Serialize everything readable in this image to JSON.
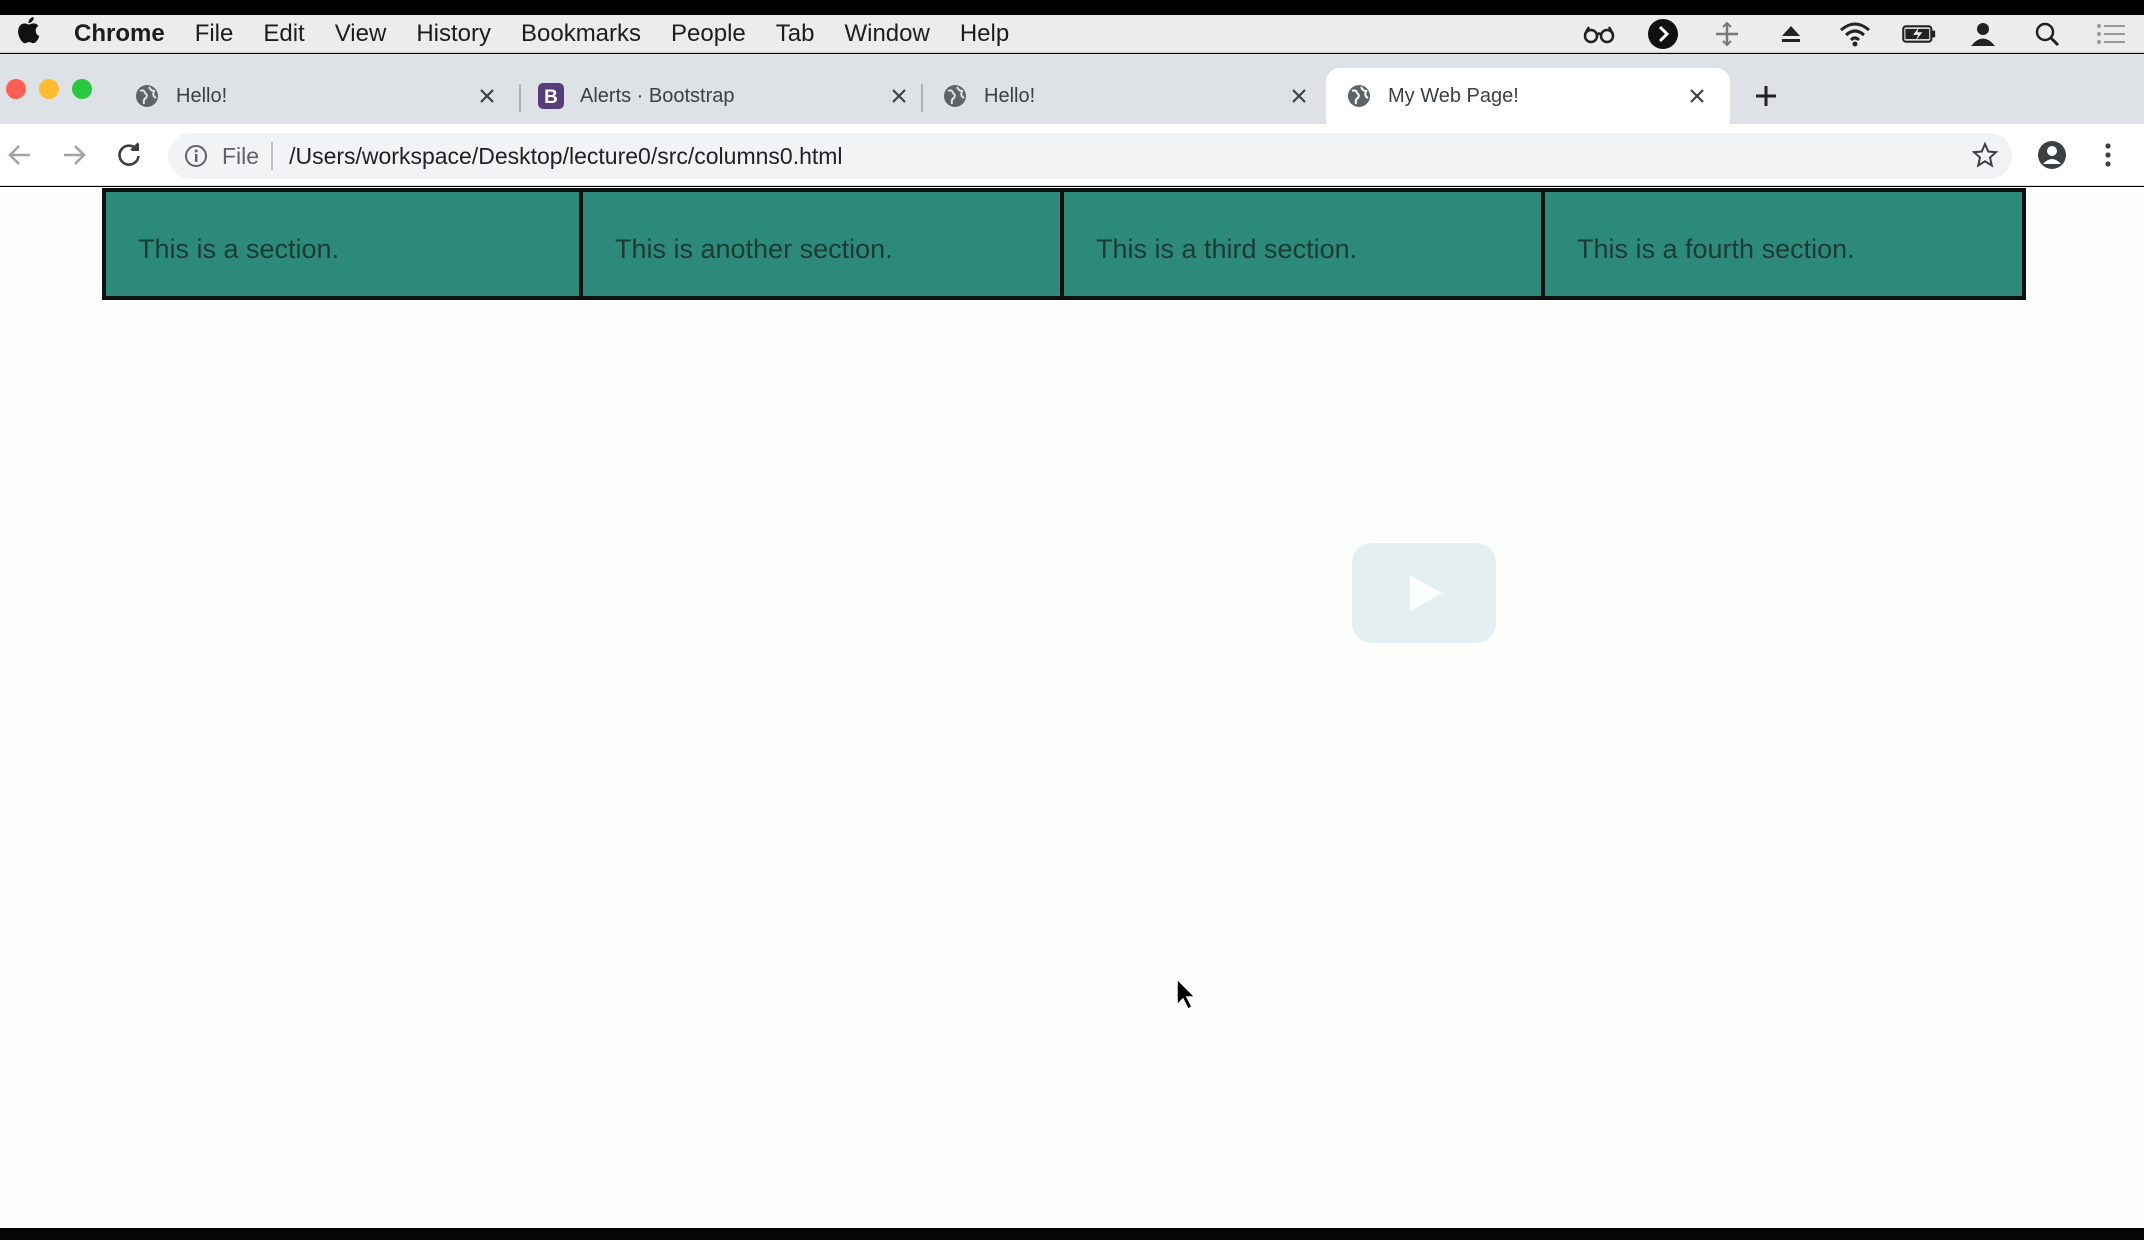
{
  "menubar": {
    "app_name": "Chrome",
    "items": [
      "File",
      "Edit",
      "View",
      "History",
      "Bookmarks",
      "People",
      "Tab",
      "Window",
      "Help"
    ]
  },
  "tabs": [
    {
      "title": "Hello!",
      "favicon": "globe-icon",
      "active": false
    },
    {
      "title": "Alerts · Bootstrap",
      "favicon": "bootstrap-logo-icon",
      "favicon_letter": "B",
      "active": false
    },
    {
      "title": "Hello!",
      "favicon": "globe-icon",
      "active": false
    },
    {
      "title": "My Web Page!",
      "favicon": "globe-icon",
      "active": true
    }
  ],
  "omnibox": {
    "scheme_label": "File",
    "url": "/Users/workspace/Desktop/lecture0/src/columns0.html"
  },
  "page": {
    "sections": [
      "This is a section.",
      "This is another section.",
      "This is a third section.",
      "This is a fourth section."
    ]
  },
  "colors": {
    "section_bg": "#2d8a7b",
    "section_border": "#101010",
    "page_bg": "#fcfefc",
    "bootstrap_purple": "#563d7c"
  }
}
